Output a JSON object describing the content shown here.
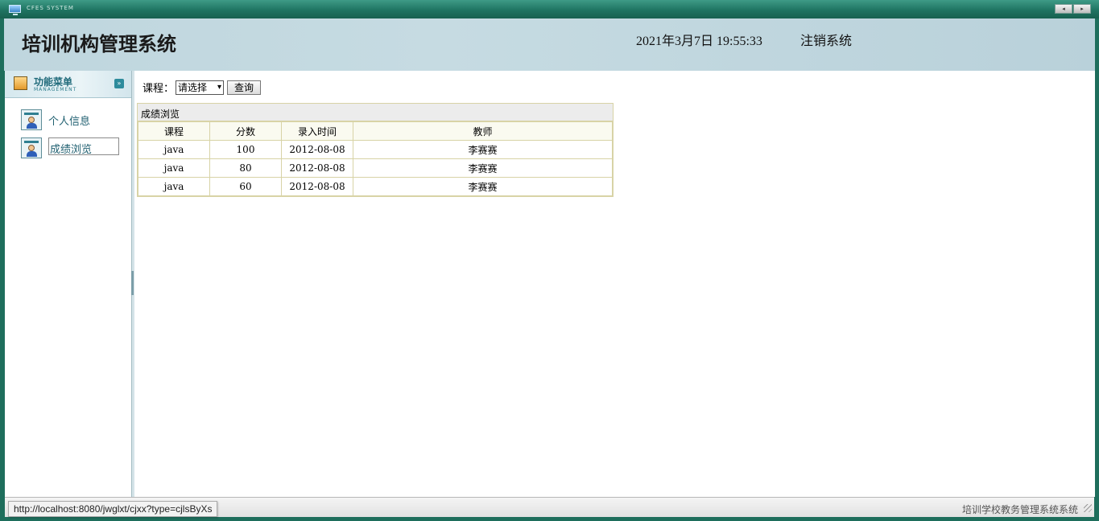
{
  "window": {
    "system_title": "CFES SYSTEM",
    "nav_prev": "◂",
    "nav_next": "▸"
  },
  "header": {
    "app_title": "培训机构管理系统",
    "datetime": "2021年3月7日 19:55:33",
    "logout_label": "注销系统"
  },
  "sidebar": {
    "menu_title": "功能菜单",
    "menu_subtitle": "MANAGEMENT",
    "collapse_glyph": "»",
    "items": [
      {
        "label": "个人信息",
        "icon": "user-card-icon"
      },
      {
        "label": "成绩浏览",
        "icon": "user-card-icon"
      }
    ]
  },
  "filter": {
    "label": "课程：",
    "selected": "请选择",
    "query_label": "查询"
  },
  "grid": {
    "caption": "成绩浏览",
    "columns": [
      "课程",
      "分数",
      "录入时间",
      "教师"
    ],
    "rows": [
      [
        "java",
        "100",
        "2012-08-08",
        "李赛赛"
      ],
      [
        "java",
        "80",
        "2012-08-08",
        "李赛赛"
      ],
      [
        "java",
        "60",
        "2012-08-08",
        "李赛赛"
      ]
    ]
  },
  "statusbar": {
    "url": "http://localhost:8080/jwglxt/cjxx?type=cjlsByXs",
    "footer": "培训学校教务管理系统系统"
  }
}
